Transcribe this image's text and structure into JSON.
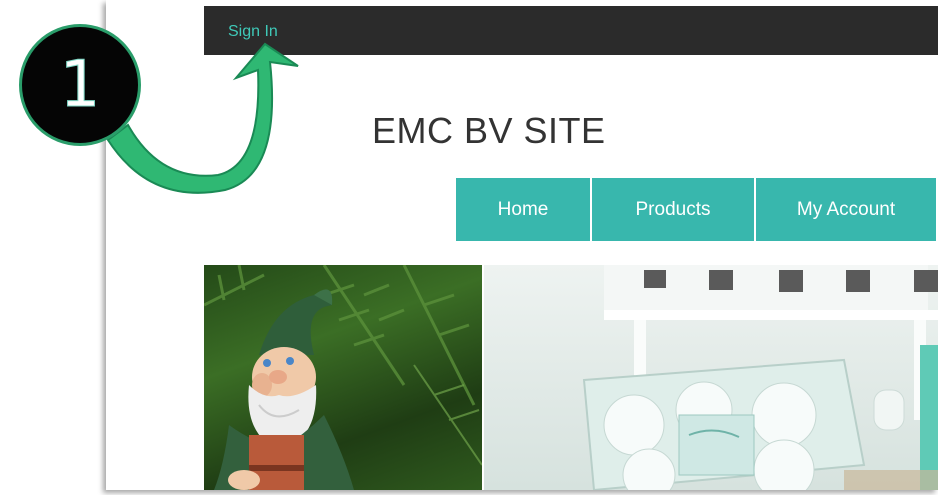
{
  "topbar": {
    "signin_label": "Sign In"
  },
  "site": {
    "title": "EMC BV SITE"
  },
  "nav": {
    "items": [
      {
        "label": "Home"
      },
      {
        "label": "Products"
      },
      {
        "label": "My Account"
      }
    ]
  },
  "annotation": {
    "step_number": "1"
  },
  "colors": {
    "topbar_bg": "#2b2b2b",
    "signin_link": "#3fc9b8",
    "nav_bg": "#38b7ad",
    "arrow_green": "#2fb873",
    "badge_bg": "#050505"
  },
  "images": {
    "left": "garden-gnome-photo",
    "right": "bath-fizzer-product-photo"
  }
}
